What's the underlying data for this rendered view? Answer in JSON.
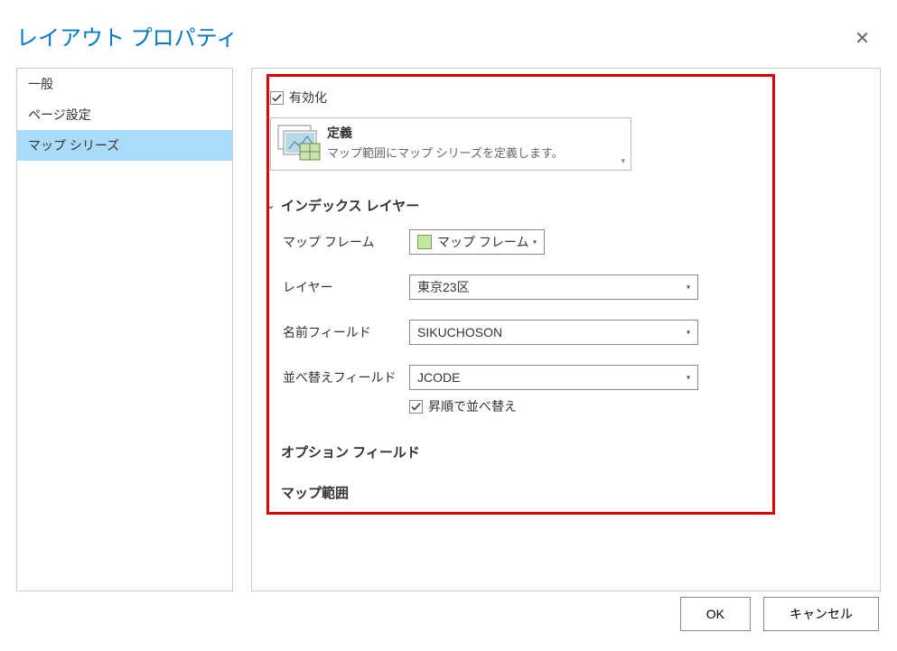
{
  "dialog": {
    "title": "レイアウト プロパティ"
  },
  "sidebar": {
    "items": [
      {
        "label": "一般",
        "selected": false
      },
      {
        "label": "ページ設定",
        "selected": false
      },
      {
        "label": "マップ シリーズ",
        "selected": true
      }
    ]
  },
  "content": {
    "enable_label": "有効化",
    "enable_checked": true,
    "definition": {
      "title": "定義",
      "description": "マップ範囲にマップ シリーズを定義します。"
    },
    "sections": {
      "index_layer": {
        "title": "インデックス レイヤー",
        "expanded": true,
        "map_frame_label": "マップ フレーム",
        "map_frame_value": "マップ フレーム",
        "layer_label": "レイヤー",
        "layer_value": "東京23区",
        "name_field_label": "名前フィールド",
        "name_field_value": "SIKUCHOSON",
        "sort_field_label": "並べ替えフィールド",
        "sort_field_value": "JCODE",
        "sort_asc_label": "昇順で並べ替え",
        "sort_asc_checked": true
      },
      "option_fields": {
        "title": "オプション フィールド",
        "expanded": false
      },
      "map_extent": {
        "title": "マップ範囲",
        "expanded": false
      }
    }
  },
  "buttons": {
    "ok": "OK",
    "cancel": "キャンセル"
  }
}
